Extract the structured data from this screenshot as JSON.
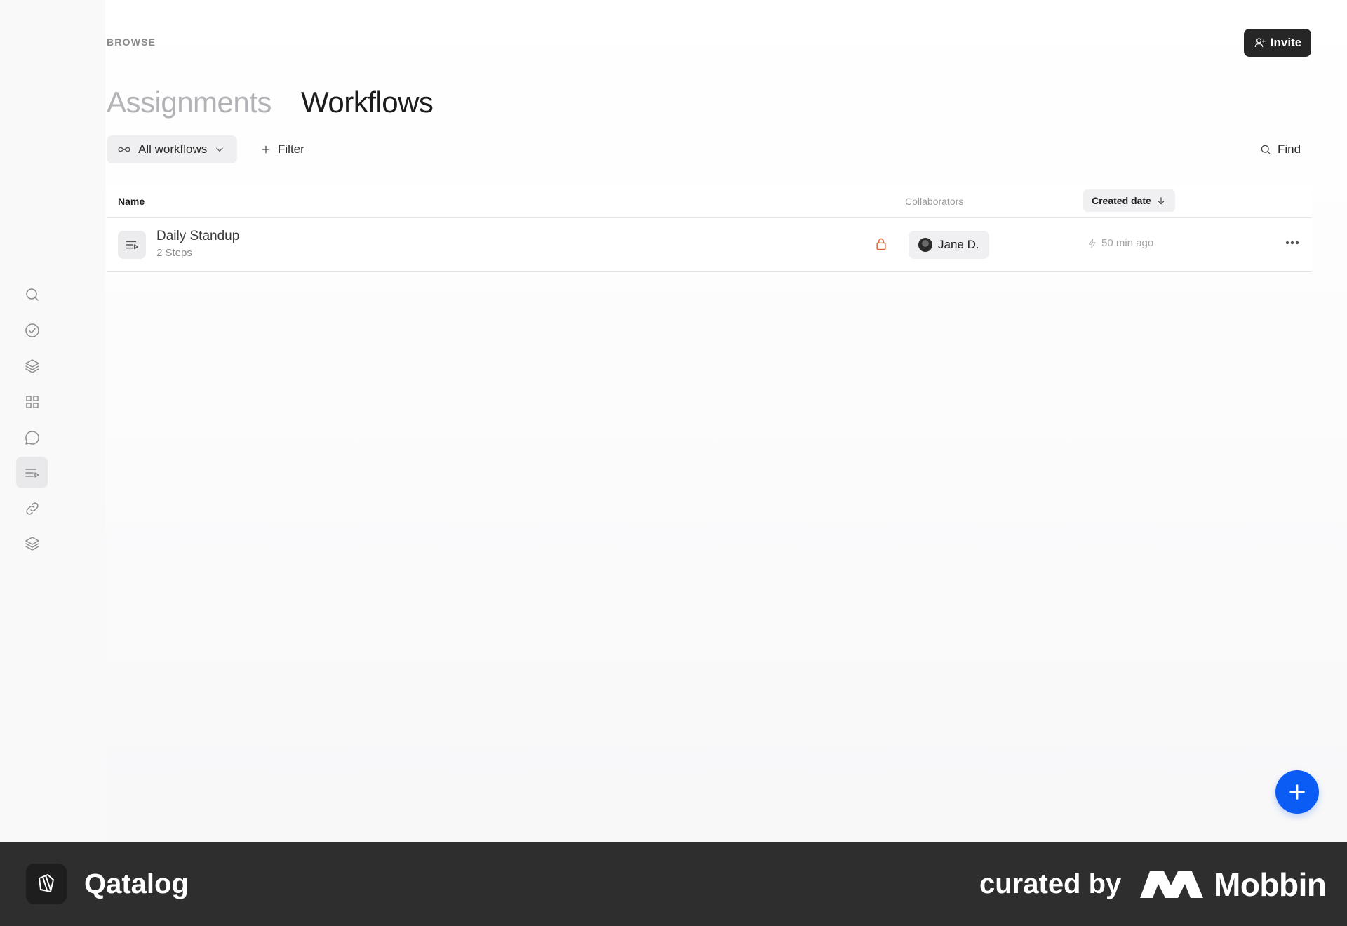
{
  "header": {
    "breadcrumb": "BROWSE",
    "invite_label": "Invite",
    "tabs": [
      {
        "label": "Assignments",
        "active": false
      },
      {
        "label": "Workflows",
        "active": true
      }
    ]
  },
  "sidebar": {
    "items": [
      {
        "icon": "search-icon",
        "active": false
      },
      {
        "icon": "check-circle-icon",
        "active": false
      },
      {
        "icon": "layers-icon",
        "active": false
      },
      {
        "icon": "grid-icon",
        "active": false
      },
      {
        "icon": "chat-bubble-icon",
        "active": false
      },
      {
        "icon": "workflow-list-icon",
        "active": true
      },
      {
        "icon": "link-icon",
        "active": false
      },
      {
        "icon": "stack-icon",
        "active": false
      }
    ]
  },
  "toolbar": {
    "dropdown_label": "All workflows",
    "filter_label": "Filter",
    "find_label": "Find"
  },
  "table": {
    "columns": {
      "name": "Name",
      "collaborators": "Collaborators",
      "created": "Created date"
    },
    "rows": [
      {
        "title": "Daily Standup",
        "subtitle": "2 Steps",
        "locked": true,
        "collaborator": "Jane D.",
        "created": "50 min ago"
      }
    ]
  },
  "colors": {
    "accent": "#0b5cf5",
    "lock": "#d9693f",
    "footer_bg": "#2e2e2f"
  },
  "footer": {
    "app_name": "Qatalog",
    "curated_by": "curated by",
    "brand": "Mobbin"
  }
}
